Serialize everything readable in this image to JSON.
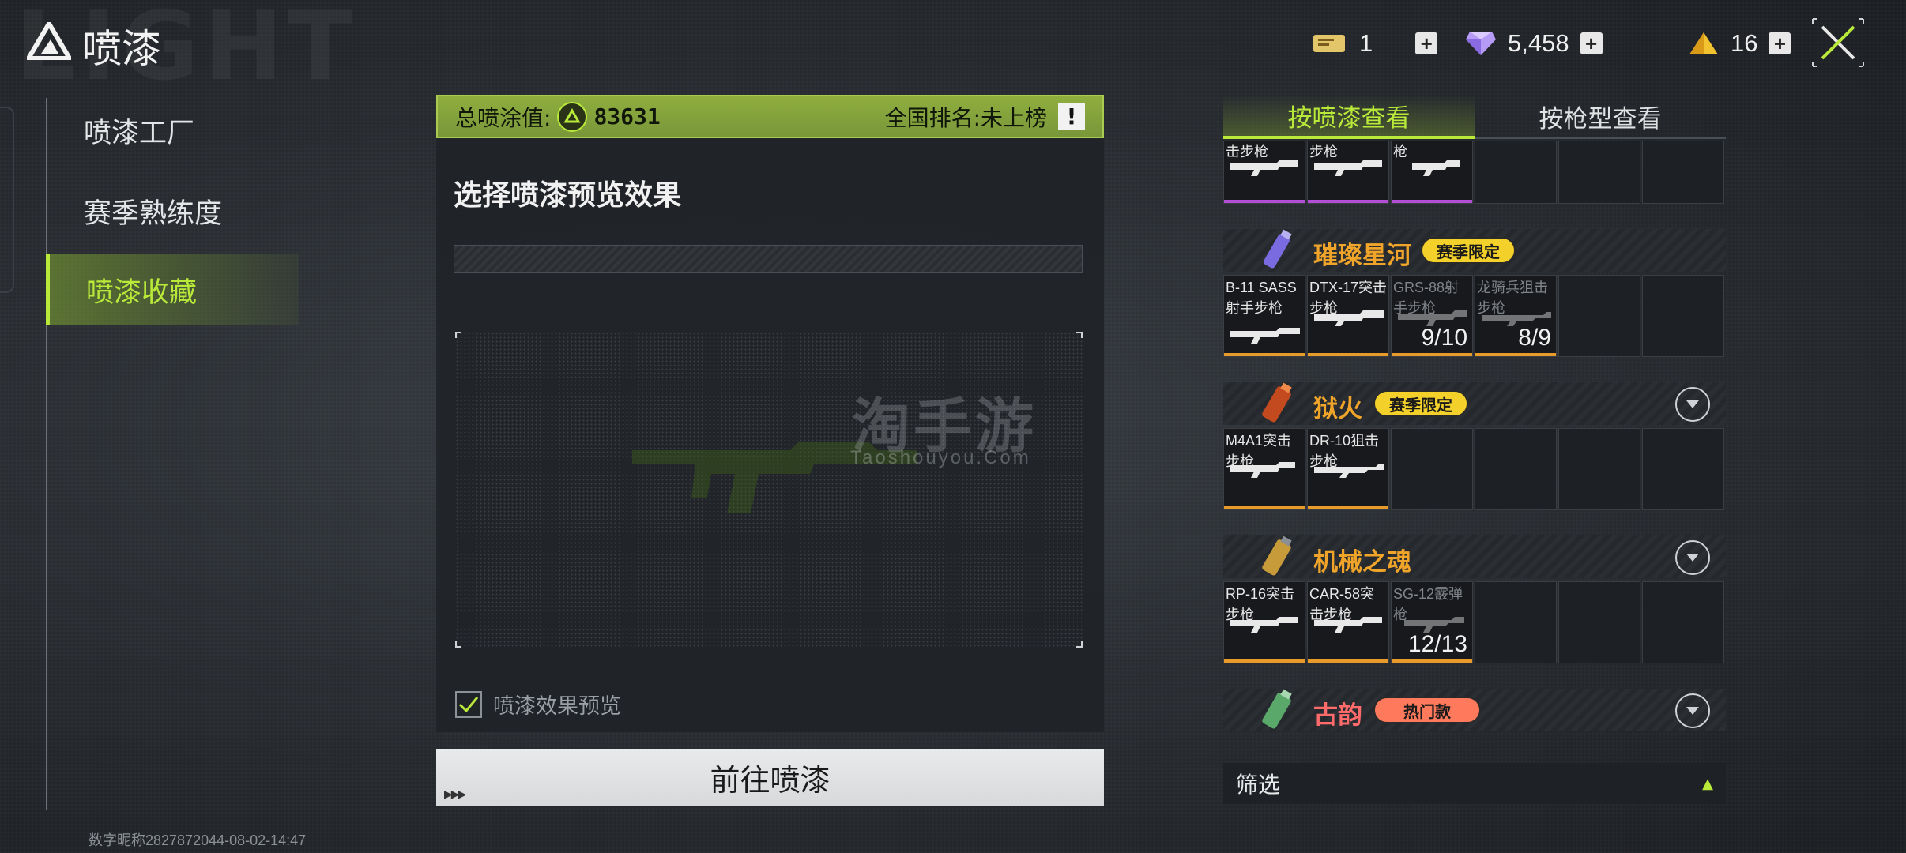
{
  "header": {
    "bg_word": "LIGHT",
    "title": "喷漆",
    "currencies": [
      {
        "icon": "ticket-icon",
        "value": "1"
      },
      {
        "icon": "diamond-icon",
        "value": "5,458"
      },
      {
        "icon": "pyramid-icon",
        "value": "16"
      }
    ]
  },
  "nav": {
    "items": [
      {
        "label": "喷漆工厂",
        "active": false
      },
      {
        "label": "赛季熟练度",
        "active": false
      },
      {
        "label": "喷漆收藏",
        "active": true
      }
    ]
  },
  "footer_note": "数字昵称2827872044-08-02-14:47",
  "stats": {
    "total_label": "总喷涂值:",
    "total_value": "83631",
    "rank_label": "全国排名:未上榜",
    "alert": "!"
  },
  "preview": {
    "title": "选择喷漆预览效果",
    "checkbox_label": "喷漆效果预览",
    "checked": true,
    "watermark": "淘手游",
    "watermark_sub": "Taoshouyou.Com"
  },
  "go_button": "前往喷漆",
  "tabs": {
    "by_paint": "按喷漆查看",
    "by_gun": "按枪型查看"
  },
  "top_partial_row": [
    {
      "label": "击步枪",
      "bar": "#b34fd6"
    },
    {
      "label": "步枪",
      "bar": "#b34fd6"
    },
    {
      "label": "枪",
      "bar": "#b34fd6"
    }
  ],
  "groups": [
    {
      "name": "璀璨星河",
      "name_color": "#f0a52a",
      "badge": "赛季限定",
      "badge_color": "#f4d12a",
      "chevron": false,
      "icon": "spray-can-icon",
      "icon_color": "#7a6ce0",
      "cells": [
        {
          "label": "B-11 SASS射手步枪",
          "dim": false,
          "count": ""
        },
        {
          "label": "DTX-17突击步枪",
          "dim": false,
          "count": ""
        },
        {
          "label": "GRS-88射手步枪",
          "dim": true,
          "count": "9/10"
        },
        {
          "label": "龙骑兵狙击步枪",
          "dim": true,
          "count": "8/9"
        }
      ]
    },
    {
      "name": "狱火",
      "name_color": "#f0a52a",
      "badge": "赛季限定",
      "badge_color": "#f4d12a",
      "chevron": true,
      "icon": "spray-can-icon",
      "icon_color": "#c24a1e",
      "cells": [
        {
          "label": "M4A1突击步枪",
          "dim": false,
          "count": ""
        },
        {
          "label": "DR-10狙击步枪",
          "dim": false,
          "count": ""
        }
      ]
    },
    {
      "name": "机械之魂",
      "name_color": "#f0a52a",
      "badge": "",
      "badge_color": "",
      "chevron": true,
      "icon": "spray-can-icon",
      "icon_color": "#c79a3a",
      "cells": [
        {
          "label": "RP-16突击步枪",
          "dim": false,
          "count": ""
        },
        {
          "label": "CAR-58突击步枪",
          "dim": false,
          "count": ""
        },
        {
          "label": "SG-12霰弹枪",
          "dim": true,
          "count": "12/13"
        }
      ]
    },
    {
      "name": "古韵",
      "name_color": "#ff6b6b",
      "badge": "热门款",
      "badge_color": "#ff7a5c",
      "chevron": true,
      "icon": "spray-can-icon",
      "icon_color": "#5aa86a",
      "cells": []
    }
  ],
  "filter": {
    "label": "筛选"
  },
  "colors": {
    "accent": "#b9ea3a",
    "rare_bar": "#e89a2a",
    "epic_bar": "#b34fd6"
  }
}
